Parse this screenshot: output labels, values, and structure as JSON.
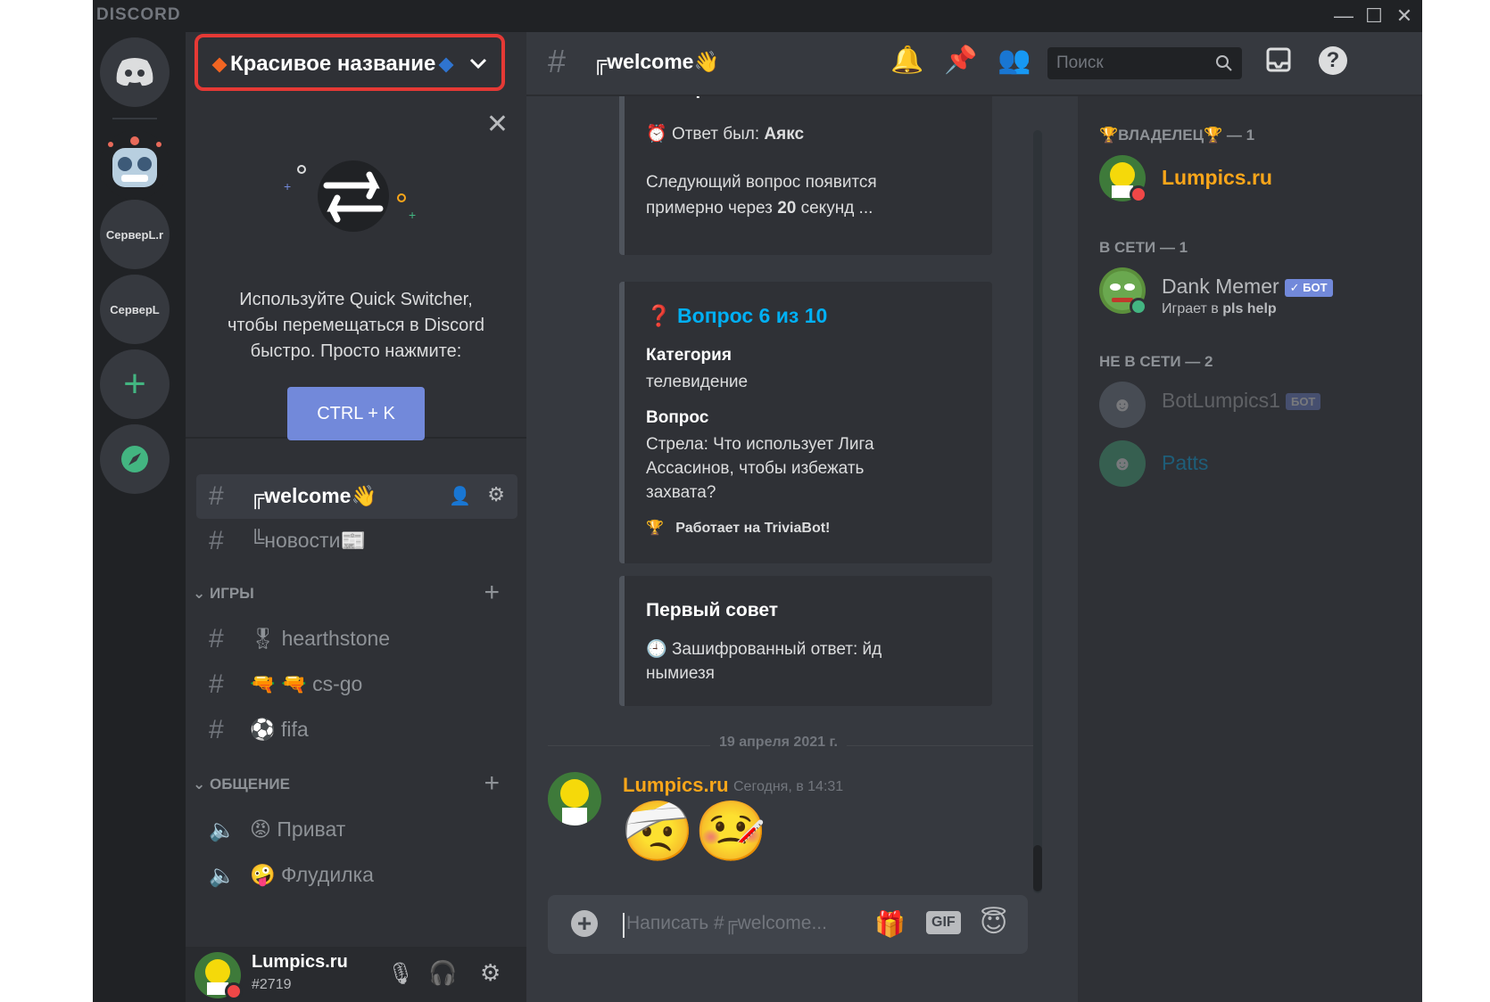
{
  "window": {
    "app_title": "DISCORD"
  },
  "server": {
    "name": "Красивое название",
    "guild_labels": [
      "СерверL.r",
      "СерверL"
    ]
  },
  "quick_switcher": {
    "text_1": "Используйте Quick Switcher,",
    "text_2": "чтобы перемещаться в Discord",
    "text_3": "быстро. Просто нажмите:",
    "shortcut": "CTRL + K"
  },
  "channels": {
    "top": [
      {
        "prefix": "╔",
        "name": "welcome",
        "emoji": "👋"
      },
      {
        "prefix": "╚",
        "name": "новости",
        "emoji": "📰"
      }
    ],
    "categories": [
      {
        "name": "ИГРЫ",
        "items": [
          {
            "prefix": "🎖",
            "name": "hearthstone"
          },
          {
            "prefix": "🔫 🔫",
            "name": "cs-go"
          },
          {
            "prefix": "⚽",
            "name": "fifa"
          }
        ]
      },
      {
        "name": "ОБЩЕНИЕ",
        "items": [
          {
            "prefix": "😡",
            "name": "Приват"
          },
          {
            "prefix": "🤪",
            "name": "Флудилка"
          }
        ]
      }
    ]
  },
  "user": {
    "name": "Lumpics.ru",
    "tag": "#2719"
  },
  "header": {
    "channel_prefix": "╔",
    "channel_name": "welcome",
    "channel_emoji": "👋",
    "search_placeholder": "Поиск"
  },
  "messages": {
    "embed1": {
      "top_text": "Вне времени!",
      "answer_prefix": "Ответ был: ",
      "answer": "Аякс",
      "next_1": "Следующий вопрос появится",
      "next_2a": "примерно через ",
      "next_2b": "20",
      "next_2c": " секунд ..."
    },
    "embed2": {
      "title": "Вопрос 6 из 10",
      "category_label": "Категория",
      "category_value": "телевидение",
      "question_label": "Вопрос",
      "q_1": "Стрела: Что использует Лига",
      "q_2": "Ассасинов, чтобы избежать",
      "q_3": "захвата?",
      "footer": "Работает на TriviaBot!"
    },
    "embed3": {
      "title": "Первый совет",
      "line_1": "Зашифрованный ответ: йд",
      "line_2": "нымиезя"
    },
    "date_divider": "19 апреля 2021 г.",
    "post": {
      "author": "Lumpics.ru",
      "time": "Сегодня, в 14:31",
      "emoji_1": "🤕",
      "emoji_2": "🤒"
    }
  },
  "composer": {
    "placeholder": "Написать #╔welcome...",
    "gif": "GIF"
  },
  "members": {
    "owner_cat": "ВЛАДЕЛЕЦ",
    "owner_count": " — 1",
    "owner_name": "Lumpics.ru",
    "online_cat": "В СЕТИ — 1",
    "online_name": "Dank Memer",
    "online_badge": "✓ БОТ",
    "online_activity_prefix": "Играет в ",
    "online_activity": "pls help",
    "offline_cat": "НЕ В СЕТИ — 2",
    "offline_1": "BotLumpics1",
    "offline_1_badge": "БОТ",
    "offline_2": "Patts"
  },
  "colors": {
    "accent": "#7289da",
    "highlight": "#e53935",
    "owner": "#faa61a",
    "online": "#43b581",
    "link": "#00b0f4"
  }
}
